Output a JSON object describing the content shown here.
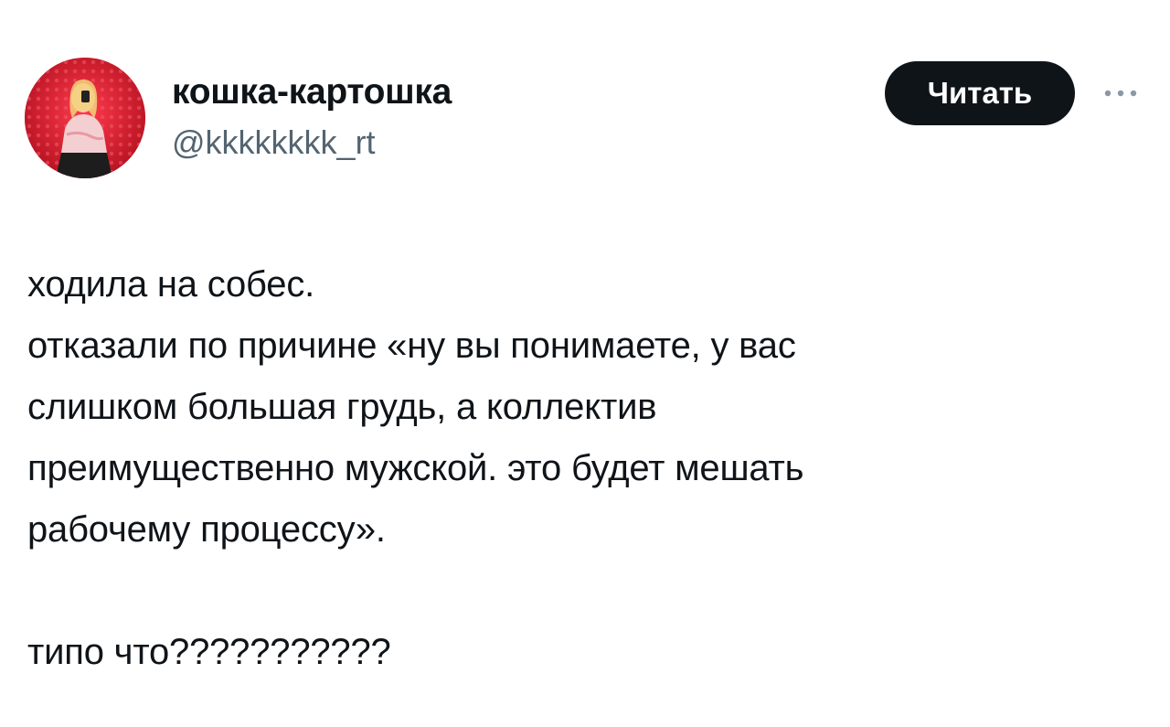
{
  "author": {
    "display_name": "кошка-картошка",
    "handle": "@kkkkkkkk_rt"
  },
  "actions": {
    "follow_label": "Читать",
    "more_icon": "more-horizontal-icon"
  },
  "tweet": {
    "paragraph1": [
      "ходила на собес.",
      "отказали по причине «ну вы понимаете, у вас",
      "слишком большая грудь, а коллектив",
      "преимущественно мужской. это будет мешать",
      "рабочему процессу»."
    ],
    "paragraph2": "типо что???????????"
  },
  "colors": {
    "text_primary": "#0f1419",
    "text_secondary": "#536471",
    "button_bg": "#0f1419",
    "avatar_bg": "#d41a2c"
  }
}
